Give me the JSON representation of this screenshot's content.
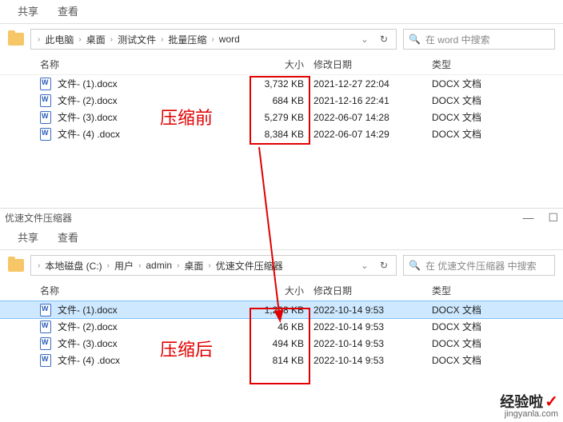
{
  "top": {
    "title": "word",
    "ribbon": {
      "tab1": "共享",
      "tab2": "查看"
    },
    "breadcrumb": [
      "此电脑",
      "桌面",
      "测试文件",
      "批量压缩",
      "word"
    ],
    "search_placeholder": "在 word 中搜索",
    "columns": {
      "name": "名称",
      "size": "大小",
      "date": "修改日期",
      "type": "类型"
    },
    "files": [
      {
        "name": "文件- (1).docx",
        "size": "3,732 KB",
        "date": "2021-12-27 22:04",
        "type": "DOCX 文档"
      },
      {
        "name": "文件- (2).docx",
        "size": "684 KB",
        "date": "2021-12-16 22:41",
        "type": "DOCX 文档"
      },
      {
        "name": "文件- (3).docx",
        "size": "5,279 KB",
        "date": "2022-06-07 14:28",
        "type": "DOCX 文档"
      },
      {
        "name": "文件- (4) .docx",
        "size": "8,384 KB",
        "date": "2022-06-07 14:29",
        "type": "DOCX 文档"
      }
    ]
  },
  "bottom": {
    "title": "优速文件压缩器",
    "ribbon": {
      "tab1": "共享",
      "tab2": "查看"
    },
    "breadcrumb": [
      "本地磁盘 (C:)",
      "用户",
      "admin",
      "桌面",
      "优速文件压缩器"
    ],
    "search_placeholder": "在 优速文件压缩器 中搜索",
    "columns": {
      "name": "名称",
      "size": "大小",
      "date": "修改日期",
      "type": "类型"
    },
    "files": [
      {
        "name": "文件- (1).docx",
        "size": "1,298 KB",
        "date": "2022-10-14 9:53",
        "type": "DOCX 文档",
        "selected": true
      },
      {
        "name": "文件- (2).docx",
        "size": "46 KB",
        "date": "2022-10-14 9:53",
        "type": "DOCX 文档"
      },
      {
        "name": "文件- (3).docx",
        "size": "494 KB",
        "date": "2022-10-14 9:53",
        "type": "DOCX 文档"
      },
      {
        "name": "文件- (4) .docx",
        "size": "814 KB",
        "date": "2022-10-14 9:53",
        "type": "DOCX 文档"
      }
    ]
  },
  "annotations": {
    "before": "压缩前",
    "after": "压缩后"
  },
  "watermark": {
    "text": "经验啦",
    "url": "jingyanla.com"
  }
}
